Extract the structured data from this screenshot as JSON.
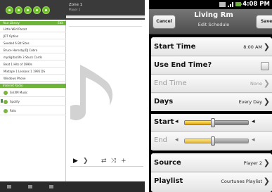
{
  "tablet": {
    "zone_title": "Zone 1",
    "zone_subtitle": "Player 1",
    "top_buttons": [
      "home-icon",
      "zones-icon",
      "search-icon",
      "settings-icon",
      "power-icon"
    ],
    "sections": [
      {
        "label": "Your Library",
        "action": "Edit"
      },
      {
        "label": "Internet Radio",
        "action": ""
      }
    ],
    "library_items": [
      "Little Wild Parrot",
      "JDT Option",
      "Seeded 6 Bit Sites",
      "Bruce Hornsby/DJ Cobra",
      "mydigitaclife 3 Stuck Cards",
      "Beat 1 Hits of 1990s",
      "Mixtape 1 Lessons 1 1995 DS",
      "Windows Phone"
    ],
    "radio_items": [
      "SiriXM Music",
      "Spotify",
      "Rdio"
    ],
    "controls": {
      "play": "▶",
      "next": "❯",
      "repeat": "⇄",
      "shuffle": "⤨",
      "add": "+"
    }
  },
  "phone": {
    "status_time": "4:08 PM",
    "title": "Living Rm",
    "subtitle": "Edit Schedule",
    "cancel_label": "Cancel",
    "save_label": "Save",
    "start_time_label": "Start Time",
    "start_time_value": "8:00 AM",
    "use_end_time_label": "Use End Time?",
    "use_end_time_checked": false,
    "end_time_label": "End Time",
    "end_time_value": "None",
    "days_label": "Days",
    "days_value": "Every Day",
    "start_volume_label": "Start",
    "end_volume_label": "End",
    "start_volume_level": 0.45,
    "end_volume_level": 0.45,
    "vol_minus_icon": "speaker-minus-icon",
    "vol_plus_icon": "speaker-plus-icon",
    "source_label": "Source",
    "source_value": "Player 2",
    "playlist_label": "Playlist",
    "playlist_value": "Courtunes Playlist",
    "colors": {
      "accent_yellow": "#f2c12e",
      "accent_green": "#6fb43a"
    }
  }
}
